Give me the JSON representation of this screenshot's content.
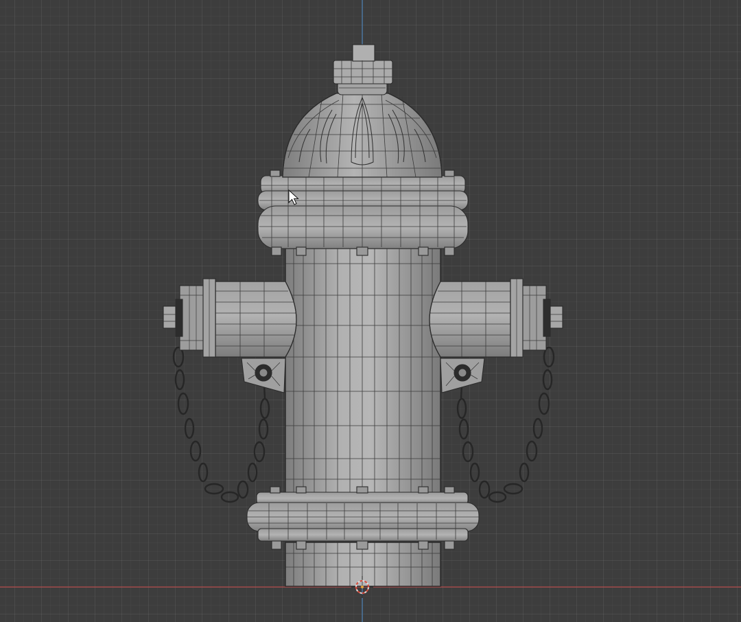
{
  "viewport": {
    "background": "#3d3d3d",
    "grid_color": "#4a4a4a",
    "x_axis_color": "#b34a4a",
    "z_axis_color": "#4a7fb3",
    "shading": "solid-wireframe",
    "model_color": "#a7a7a7",
    "edge_color": "#2b2b2b"
  },
  "objects": {
    "model": "fire-hydrant",
    "cursor_icon": "3d-cursor",
    "pointer_icon": "mouse-pointer-icon"
  }
}
